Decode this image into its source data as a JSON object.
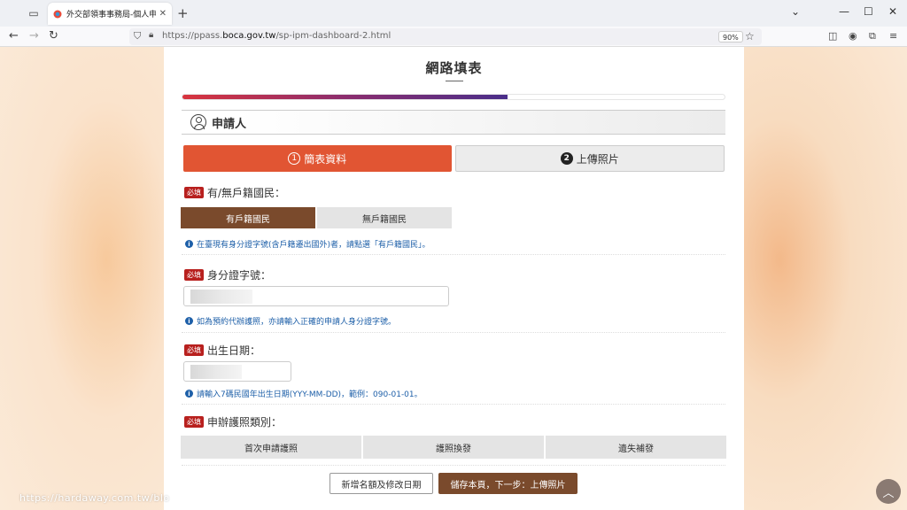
{
  "browser": {
    "tab_title": "外交部領事事務局-個人申辦護照",
    "url_prefix": "https://ppass.",
    "url_domain": "boca.gov.tw",
    "url_path": "/sp-ipm-dashboard-2.html",
    "zoom": "90%"
  },
  "page": {
    "title": "網路填表",
    "progress_percent": 60,
    "section_label": "申請人",
    "steps": [
      {
        "num": "1",
        "label": "簡表資料"
      },
      {
        "num": "2",
        "label": "上傳照片"
      }
    ],
    "required_tag": "必填",
    "nationality": {
      "label": "有/無戶籍國民：",
      "options": [
        "有戶籍國民",
        "無戶籍國民"
      ],
      "note": "在臺現有身分證字號(含戶籍遷出國外)者，請點選「有戶籍國民」。"
    },
    "id_number": {
      "label": "身分證字號：",
      "note": "如為預約代辦護照，亦請輸入正確的申請人身分證字號。"
    },
    "birth_date": {
      "label": "出生日期：",
      "note": "請輸入7碼民國年出生日期(YYY-MM-DD)，範例：090-01-01。"
    },
    "passport_type": {
      "label": "申辦護照類別：",
      "options": [
        "首次申請護照",
        "護照換發",
        "遺失補發"
      ]
    },
    "buttons": {
      "add_name": "新增名額及修改日期",
      "save_next": "儲存本頁，下一步：上傳照片"
    }
  },
  "watermark": "https://hardaway.com.tw/blo"
}
